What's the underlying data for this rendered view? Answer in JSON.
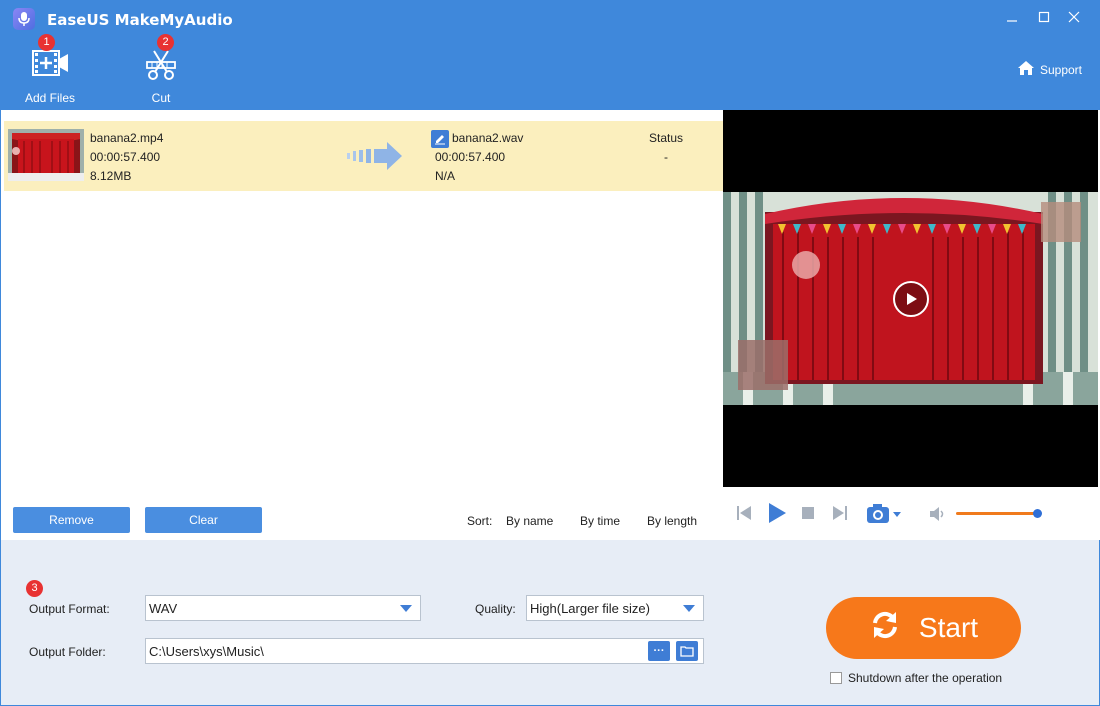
{
  "app": {
    "title": "EaseUS MakeMyAudio"
  },
  "toolbar": {
    "add_files": {
      "label": "Add Files",
      "badge": "1"
    },
    "cut": {
      "label": "Cut",
      "badge": "2"
    },
    "support": "Support"
  },
  "file": {
    "source_name": "banana2.mp4",
    "source_duration": "00:00:57.400",
    "source_size": "8.12MB",
    "output_name": "banana2.wav",
    "output_duration": "00:00:57.400",
    "output_size": "N/A",
    "status_header": "Status",
    "status_value": "-"
  },
  "list_actions": {
    "remove": "Remove",
    "clear": "Clear"
  },
  "sort": {
    "label": "Sort:",
    "by_name": "By name",
    "by_time": "By time",
    "by_length": "By length"
  },
  "settings": {
    "step_badge": "3",
    "output_format_label": "Output Format:",
    "output_format_value": "WAV",
    "quality_label": "Quality:",
    "quality_value": "High(Larger file size)",
    "output_folder_label": "Output Folder:",
    "output_folder_value": "C:\\Users\\xys\\Music\\",
    "browse_label": "···"
  },
  "start": {
    "label": "Start"
  },
  "shutdown": {
    "label": "Shutdown after the operation",
    "checked": false
  },
  "player": {
    "volume": 0.9
  },
  "colors": {
    "header": "#3f88db",
    "accent": "#f7781a",
    "selected_row": "#fbefbe",
    "button": "#4a8ee0"
  }
}
